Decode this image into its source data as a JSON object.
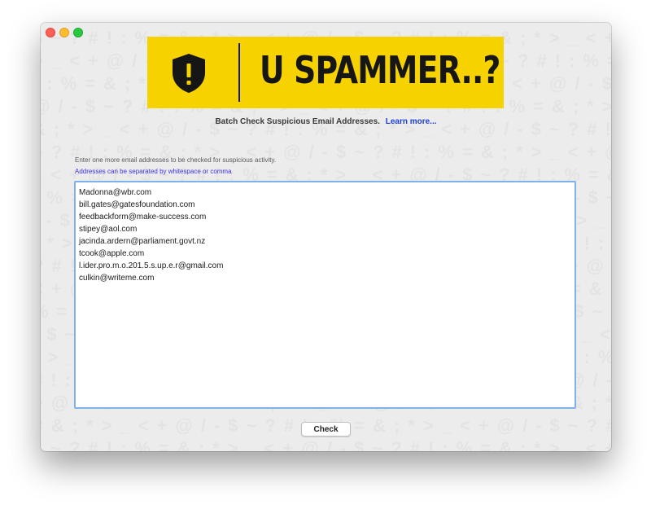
{
  "window": {
    "traffic_lights": [
      "close",
      "minimize",
      "zoom"
    ]
  },
  "banner": {
    "icon": "shield-exclamation-icon",
    "title": "U SPAMMER..?",
    "background_color": "#f6d200"
  },
  "header": {
    "subtitle": "Batch Check Suspicious Email Addresses.",
    "learn_more": "Learn more..."
  },
  "form": {
    "instruction": "Enter one more email addresses to be checked for suspicious activity.",
    "hint": "Addresses can be separated by whitespace or comma",
    "emails_value": "Madonna@wbr.com\nbill.gates@gatesfoundation.com\nfeedbackform@make-success.com\nstipey@aol.com\njacinda.ardern@parliament.govt.nz\ntcook@apple.com\nl.ider.pro.m.o.201.5.s.up.e.r@gmail.com\nculkin@writeme.com",
    "check_label": "Check"
  },
  "colors": {
    "accent_link": "#1d3fd6",
    "hint_text": "#3e31e6",
    "focus_ring": "#7fb1ec"
  }
}
